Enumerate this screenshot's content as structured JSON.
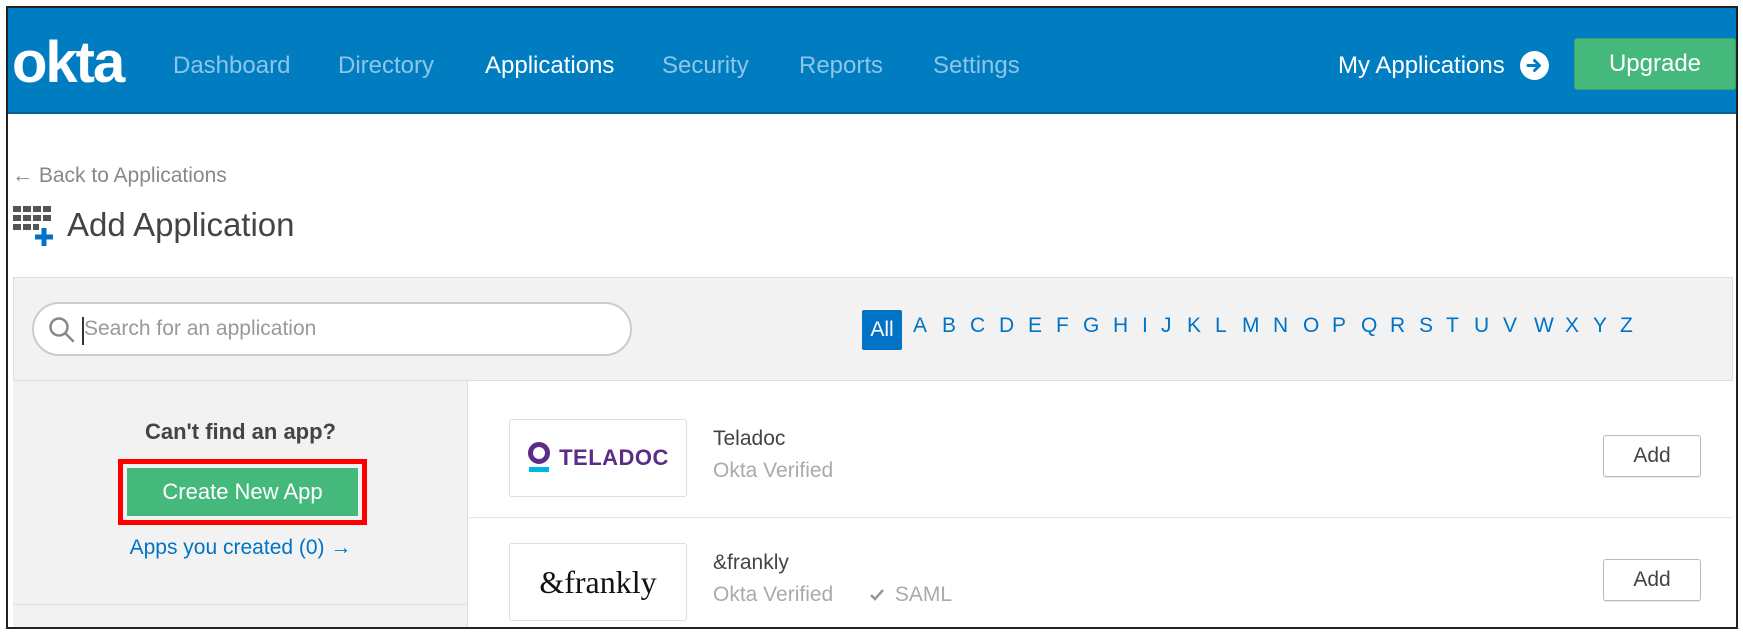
{
  "brand": {
    "logo_text": "okta",
    "nav_color": "#007dc1",
    "accent_green": "#45b97c"
  },
  "nav": {
    "items": [
      {
        "label": "Dashboard",
        "active": false
      },
      {
        "label": "Directory",
        "active": false
      },
      {
        "label": "Applications",
        "active": true
      },
      {
        "label": "Security",
        "active": false
      },
      {
        "label": "Reports",
        "active": false
      },
      {
        "label": "Settings",
        "active": false
      }
    ],
    "my_applications": "My Applications",
    "upgrade": "Upgrade"
  },
  "header": {
    "back_link": "← Back to Applications",
    "title": "Add Application"
  },
  "search": {
    "placeholder": "Search for an application",
    "value": ""
  },
  "alphabet": {
    "selected": "All",
    "letters": [
      "A",
      "B",
      "C",
      "D",
      "E",
      "F",
      "G",
      "H",
      "I",
      "J",
      "K",
      "L",
      "M",
      "N",
      "O",
      "P",
      "Q",
      "R",
      "S",
      "T",
      "U",
      "V",
      "W",
      "X",
      "Y",
      "Z"
    ]
  },
  "sidebar": {
    "prompt": "Can't find an app?",
    "create_button": "Create New App",
    "apps_created_link": "Apps you created (0) →"
  },
  "apps": [
    {
      "name": "Teladoc",
      "verified": "Okta Verified",
      "saml": "",
      "logo_text": "TELADOC",
      "add_label": "Add"
    },
    {
      "name": "&frankly",
      "verified": "Okta Verified",
      "saml": "SAML",
      "logo_text": "&frankly",
      "add_label": "Add"
    }
  ]
}
